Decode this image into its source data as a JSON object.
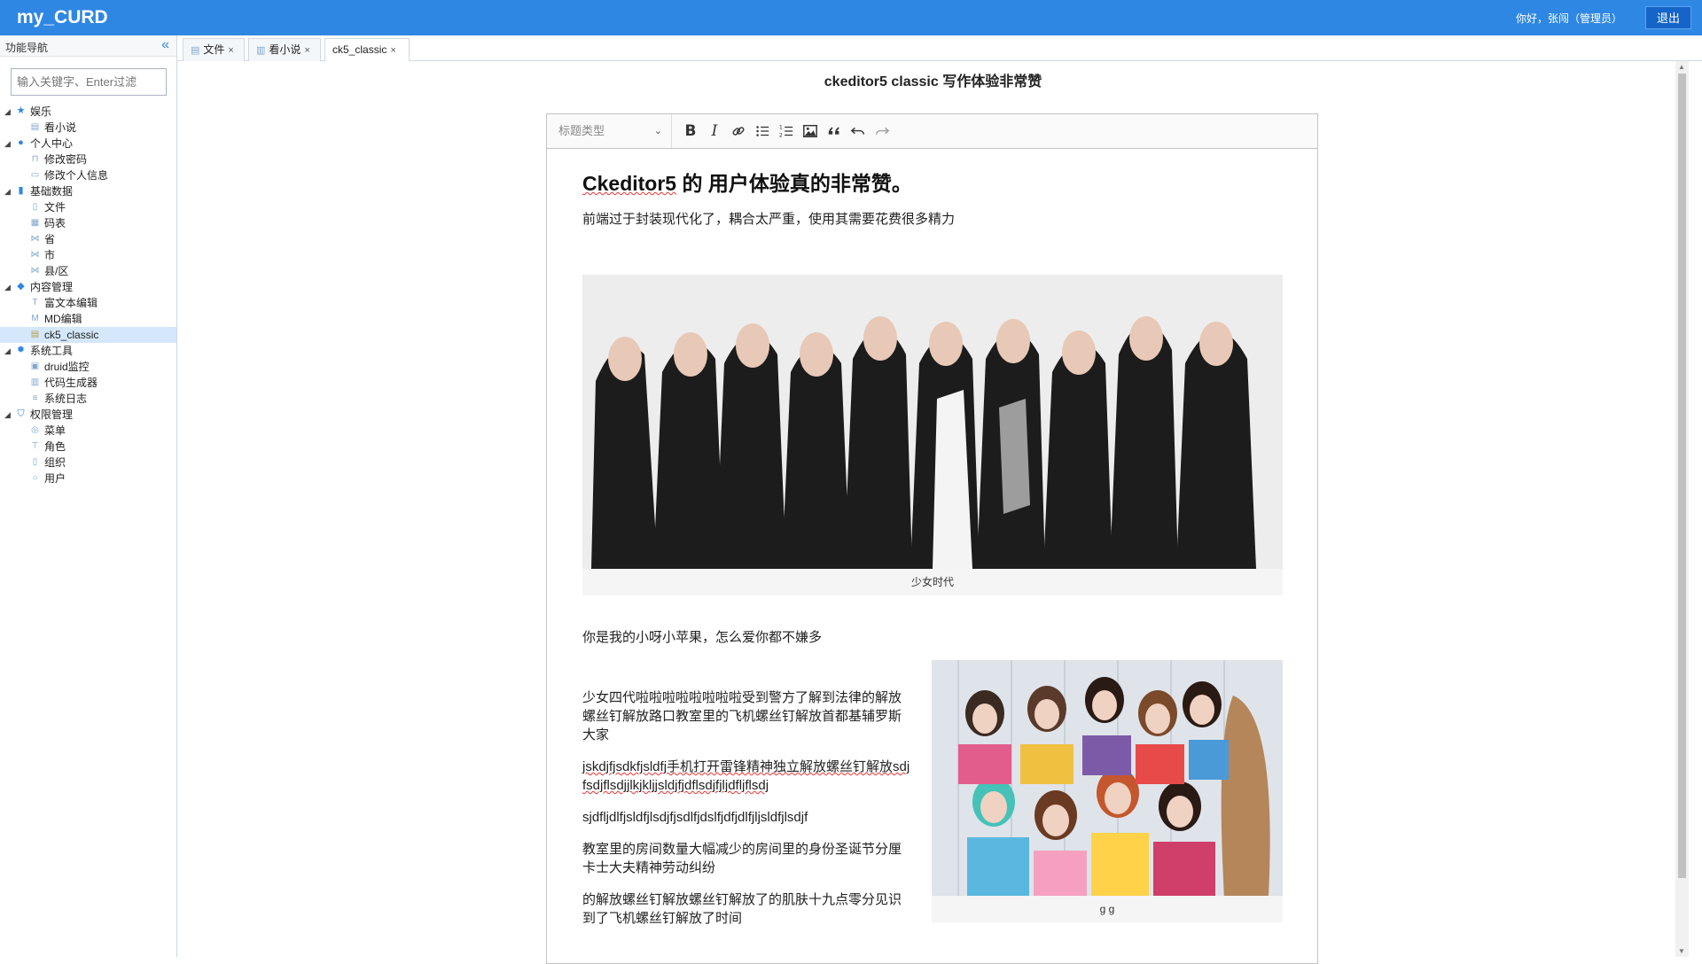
{
  "app": {
    "title": "my_CURD",
    "greeting": "你好，张闯（管理员）",
    "logout_label": "退出"
  },
  "sidebar": {
    "header": "功能导航",
    "filter_placeholder": "输入关键字、Enter过滤",
    "tree": [
      {
        "label": "娱乐",
        "icon": "star-icon",
        "children": [
          {
            "label": "看小说",
            "icon": "book-icon"
          }
        ]
      },
      {
        "label": "个人中心",
        "icon": "user-icon",
        "children": [
          {
            "label": "修改密码",
            "icon": "lock-icon"
          },
          {
            "label": "修改个人信息",
            "icon": "id-card-icon"
          }
        ]
      },
      {
        "label": "基础数据",
        "icon": "bar-chart-icon",
        "children": [
          {
            "label": "文件",
            "icon": "file-icon"
          },
          {
            "label": "码表",
            "icon": "table-icon"
          },
          {
            "label": "省",
            "icon": "network-icon"
          },
          {
            "label": "市",
            "icon": "network-icon"
          },
          {
            "label": "县/区",
            "icon": "network-icon"
          }
        ]
      },
      {
        "label": "内容管理",
        "icon": "cube-icon",
        "children": [
          {
            "label": "富文本编辑",
            "icon": "text-icon"
          },
          {
            "label": "MD编辑",
            "icon": "markdown-icon"
          },
          {
            "label": "ck5_classic",
            "icon": "note-icon",
            "selected": true
          }
        ]
      },
      {
        "label": "系统工具",
        "icon": "gear-icon",
        "children": [
          {
            "label": "druid监控",
            "icon": "monitor-icon"
          },
          {
            "label": "代码生成器",
            "icon": "code-icon"
          },
          {
            "label": "系统日志",
            "icon": "log-icon"
          }
        ]
      },
      {
        "label": "权限管理",
        "icon": "shield-icon",
        "children": [
          {
            "label": "菜单",
            "icon": "menu-icon"
          },
          {
            "label": "角色",
            "icon": "role-icon"
          },
          {
            "label": "组织",
            "icon": "org-icon"
          },
          {
            "label": "用户",
            "icon": "person-icon"
          }
        ]
      }
    ]
  },
  "tabs": [
    {
      "label": "文件",
      "icon": "file-icon",
      "active": false
    },
    {
      "label": "看小说",
      "icon": "book-icon",
      "active": false
    },
    {
      "label": "ck5_classic",
      "active": true
    }
  ],
  "page": {
    "title": "ckeditor5 classic 写作体验非常赞"
  },
  "editor": {
    "heading_select": "标题类型",
    "toolbar": [
      "bold-icon",
      "italic-icon",
      "link-icon",
      "bulleted-list-icon",
      "numbered-list-icon",
      "image-icon",
      "blockquote-icon",
      "undo-icon",
      "redo-icon"
    ],
    "heading_prefix": "Ckeditor5",
    "heading_suffix": " 的 用户体验真的非常赞。",
    "para1": "前端过于封装现代化了，耦合太严重，使用其需要花费很多精力",
    "image1_caption": "少女时代",
    "para2": "你是我的小呀小苹果，怎么爱你都不嫌多",
    "col_paragraphs": [
      "少女四代啦啦啦啦啦啦啦啦受到警方了解到法律的解放螺丝钉解放路口教室里的飞机螺丝钉解放首都基辅罗斯大家",
      "jskdjfjsdkfjsldfj手机打开雷锋精神独立解放螺丝钉解放sdjfsdjflsdjjlkjkljjsldjfjdflsdjfjljdfljflsdj",
      "sjdfljdlfjsldfjlsdjfjsdlfjdslfjdfjdlfjljsldfjlsdjf",
      "教室里的房间数量大幅减少的房间里的身份圣诞节分厘卡士大夫精神劳动纠纷",
      "的解放螺丝钉解放螺丝钉解放了的肌肤十九点零分见识到了飞机螺丝钉解放了时间"
    ],
    "image2_caption": "g g"
  }
}
